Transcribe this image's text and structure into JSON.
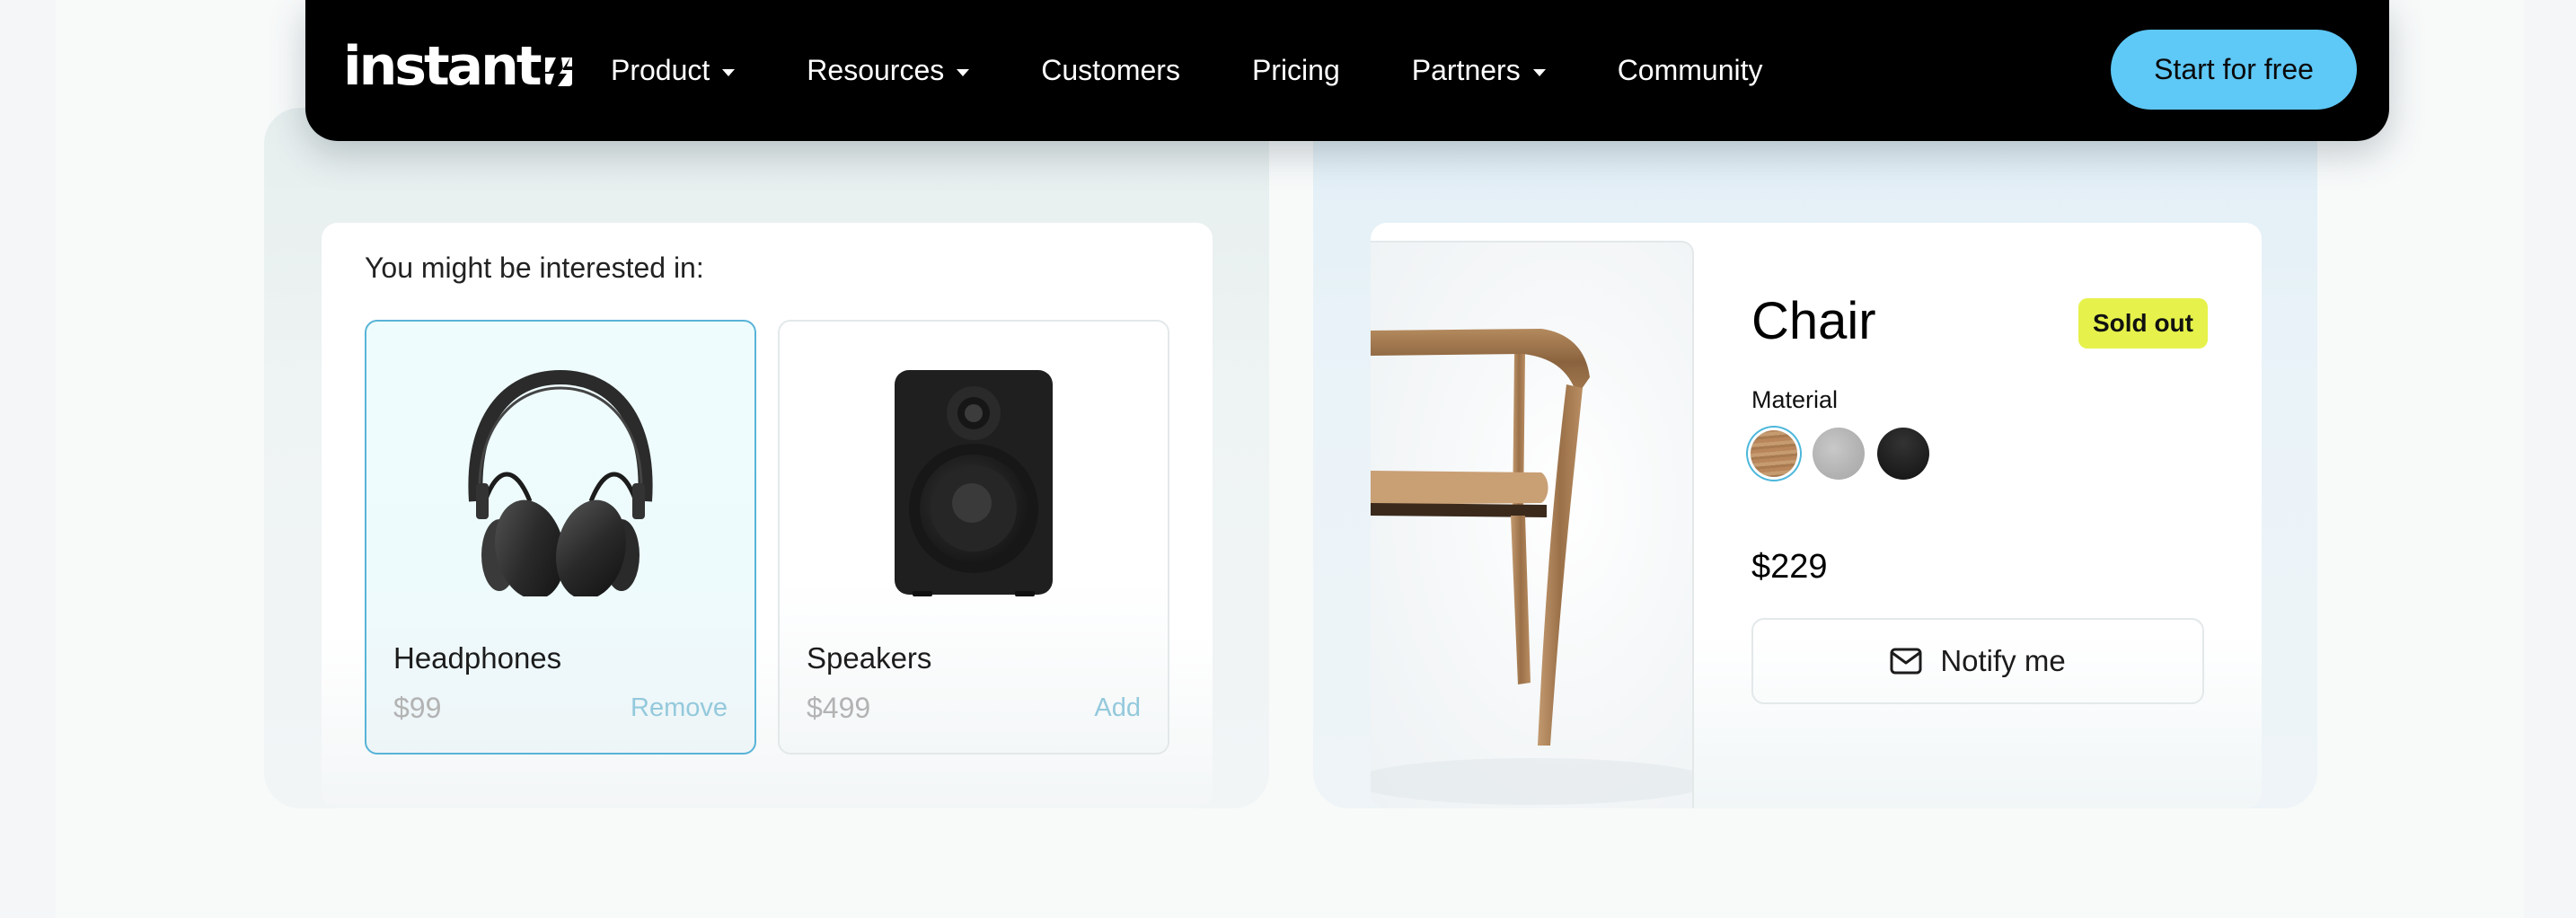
{
  "navbar": {
    "logo": "instant",
    "logo_icon": "bolt-mark-icon",
    "items": [
      {
        "label": "Product",
        "dropdown": true
      },
      {
        "label": "Resources",
        "dropdown": true
      },
      {
        "label": "Customers",
        "dropdown": false
      },
      {
        "label": "Pricing",
        "dropdown": false
      },
      {
        "label": "Partners",
        "dropdown": true
      },
      {
        "label": "Community",
        "dropdown": false
      }
    ],
    "cta_label": "Start for free",
    "cta_color": "#5ec8f6"
  },
  "recommendations": {
    "title": "You might be interested in:",
    "products": [
      {
        "name": "Headphones",
        "price": "$99",
        "action": "Remove",
        "selected": true,
        "icon": "headphones-image"
      },
      {
        "name": "Speakers",
        "price": "$499",
        "action": "Add",
        "selected": false,
        "icon": "speaker-image"
      }
    ]
  },
  "product_detail": {
    "name": "Chair",
    "badge": "Sold out",
    "badge_color": "#e6f24b",
    "material_label": "Material",
    "materials": [
      {
        "name": "wood",
        "selected": true
      },
      {
        "name": "concrete",
        "selected": false
      },
      {
        "name": "black",
        "selected": false
      }
    ],
    "price": "$229",
    "notify_label": "Notify me",
    "notify_icon": "mail-icon"
  },
  "colors": {
    "accent": "#58b4d8",
    "navbar_bg": "#000000"
  }
}
